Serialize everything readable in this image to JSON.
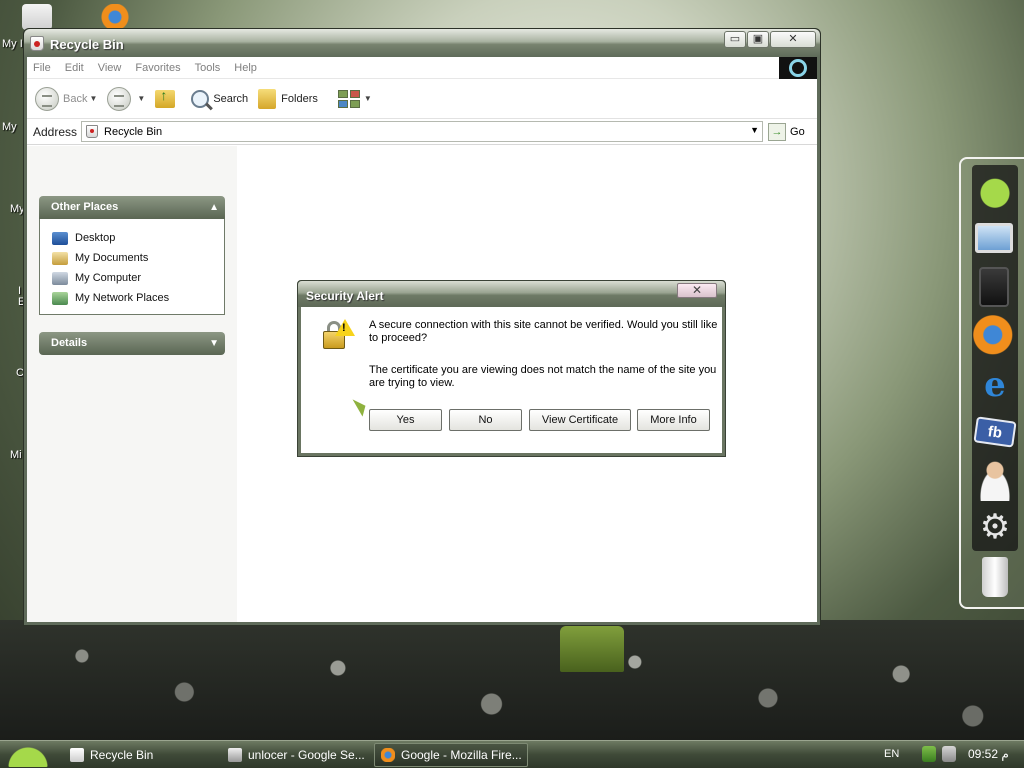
{
  "desktop": {
    "icon_labels": [
      "My I",
      "My",
      "My",
      "I\nE",
      "C",
      "Mi"
    ]
  },
  "window": {
    "title": "Recycle Bin",
    "buttons": {
      "minimize": "▭",
      "maximize": "▣",
      "close": "✕"
    }
  },
  "menubar": {
    "items": [
      "File",
      "Edit",
      "View",
      "Favorites",
      "Tools",
      "Help"
    ]
  },
  "toolbar": {
    "back": "Back",
    "search": "Search",
    "folders": "Folders"
  },
  "address": {
    "label": "Address",
    "value": "Recycle Bin",
    "go": "Go"
  },
  "task_pane": {
    "other_places": {
      "title": "Other Places",
      "items": [
        "Desktop",
        "My Documents",
        "My Computer",
        "My Network Places"
      ]
    },
    "details": {
      "title": "Details"
    }
  },
  "dialog": {
    "title": "Security Alert",
    "message_1": "A secure connection with this site cannot be verified. Would you still like to proceed?",
    "message_2": "The certificate you are viewing does not match the name of the site you are trying to view.",
    "buttons": [
      "Yes",
      "No",
      "View Certificate",
      "More Info"
    ]
  },
  "dock": {
    "icons": [
      "android-icon",
      "computer-icon",
      "tablet-icon",
      "firefox-icon",
      "internet-explorer-icon",
      "facebook-icon",
      "user-support-icon",
      "settings-gear-icon",
      "trash-icon"
    ],
    "fb_text": "fb"
  },
  "taskbar": {
    "tasks": [
      "Recycle Bin",
      "unlocer - Google Se...",
      "Google - Mozilla Fire..."
    ],
    "active_index": 2,
    "language": "EN",
    "time": "09:52 م"
  },
  "colors": {
    "title_bar": "#5f6b5a",
    "panel_header": "#6f7a68",
    "accent_green": "#8fb23f"
  }
}
